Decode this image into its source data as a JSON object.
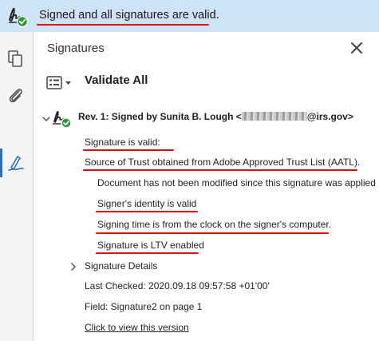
{
  "banner": {
    "text": "Signed and all signatures are valid."
  },
  "panel": {
    "title": "Signatures",
    "validate_all_label": "Validate All"
  },
  "revision": {
    "label_prefix": "Rev. 1: Signed by Sunita B. Lough <",
    "label_suffix": "@irs.gov>",
    "status_lines": [
      "Signature is valid:",
      "Source of Trust obtained from Adobe Approved Trust List (AATL).",
      "Document has not been modified since this signature was applied",
      "Signer's identity is valid",
      "Signing time is from the clock on the signer's computer.",
      "Signature is LTV enabled"
    ],
    "details_label": "Signature Details",
    "last_checked": "Last Checked: 2020.09.18 09:57:58 +01'00'",
    "field": "Field: Signature2 on page 1",
    "view_version_link": "Click to view this version"
  },
  "icons": {
    "banner": "signed-valid-icon",
    "sidebar": [
      "pages-icon",
      "attachments-icon",
      "signatures-icon"
    ],
    "close": "close-icon",
    "options": "options-menu-icon",
    "revision": "signed-valid-icon"
  },
  "colors": {
    "banner_bg": "#cfe3f6",
    "accent_blue": "#2c6fb7",
    "valid_green": "#2e9b3a",
    "annotation_red": "#dd1111"
  }
}
